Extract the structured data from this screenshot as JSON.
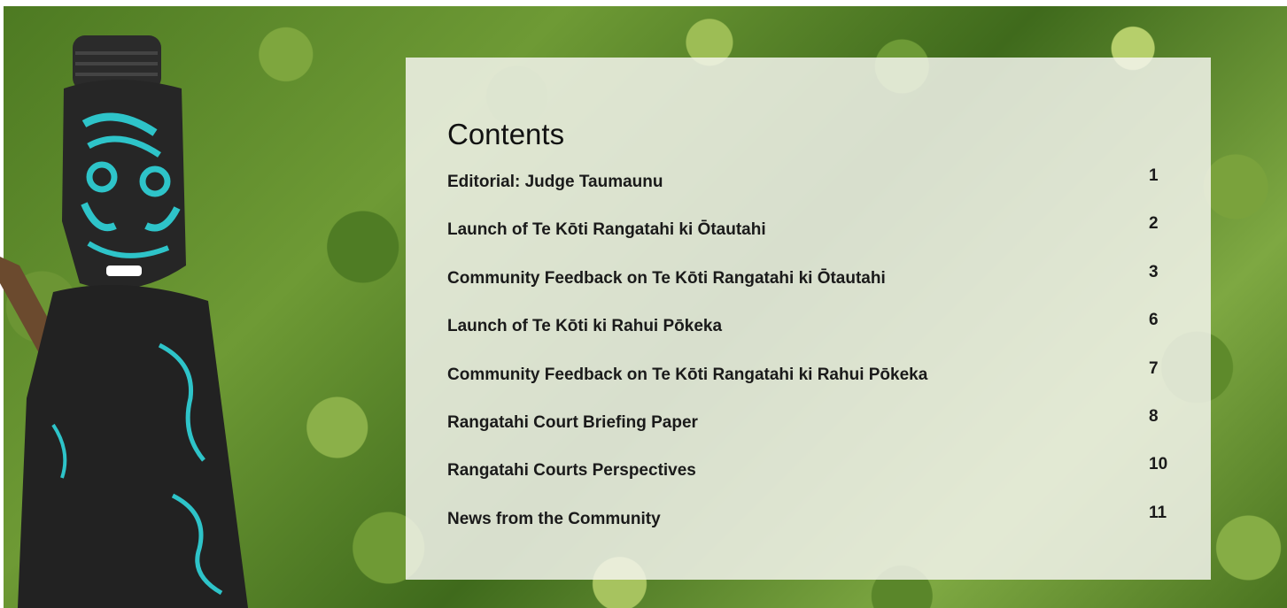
{
  "contents": {
    "heading": "Contents",
    "items": [
      {
        "title": "Editorial: Judge Taumaunu",
        "page": "1"
      },
      {
        "title": "Launch of Te Kōti Rangatahi ki Ōtautahi",
        "page": "2"
      },
      {
        "title": "Community Feedback on Te Kōti Rangatahi ki Ōtautahi",
        "page": "3"
      },
      {
        "title": "Launch of Te Kōti ki Rahui Pōkeka",
        "page": "6"
      },
      {
        "title": "Community Feedback on Te Kōti Rangatahi ki Rahui Pōkeka",
        "page": "7"
      },
      {
        "title": "Rangatahi Court Briefing Paper",
        "page": "8"
      },
      {
        "title": "Rangatahi Courts Perspectives",
        "page": "10"
      },
      {
        "title": "News from the Community",
        "page": "11"
      }
    ]
  },
  "colors": {
    "panel_background": "#f6f6f0",
    "text": "#1a1a1a",
    "foliage": "#5f8d2d",
    "carving_dark": "#2a2a2a",
    "carving_accent": "#2ec4c9"
  },
  "images": {
    "background": "foliage-photo",
    "figure": "maori-carved-figure"
  }
}
